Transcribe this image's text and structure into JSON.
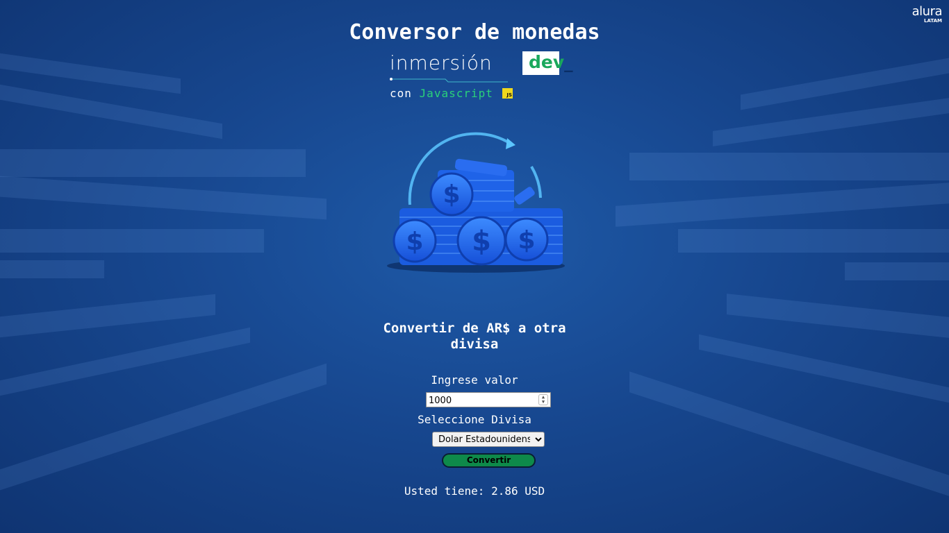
{
  "header": {
    "title": "Conversor de monedas",
    "brand_word": "inmersión",
    "brand_dev": "dev",
    "brand_dev_suffix": "_",
    "brand_con": "con",
    "brand_lang": "Javascript",
    "js_badge": "JS"
  },
  "logo": {
    "word": "alura",
    "sub": "LATAM"
  },
  "main": {
    "subtitle": "Convertir de AR$ a otra divisa",
    "value_label": "Ingrese valor",
    "value_input": "1000",
    "currency_label": "Seleccione Divisa",
    "currency_selected": "Dolar Estadounidense",
    "convert_button": "Convertir",
    "result": "Usted tiene: 2.86 USD"
  },
  "colors": {
    "background": "#17478f",
    "button": "#0e8a4a",
    "accent_green": "#2ad17a",
    "js_yellow": "#f0d81d"
  },
  "icons": {
    "hero": "coins-stack-icon",
    "spinner": "number-spinner-icon"
  }
}
